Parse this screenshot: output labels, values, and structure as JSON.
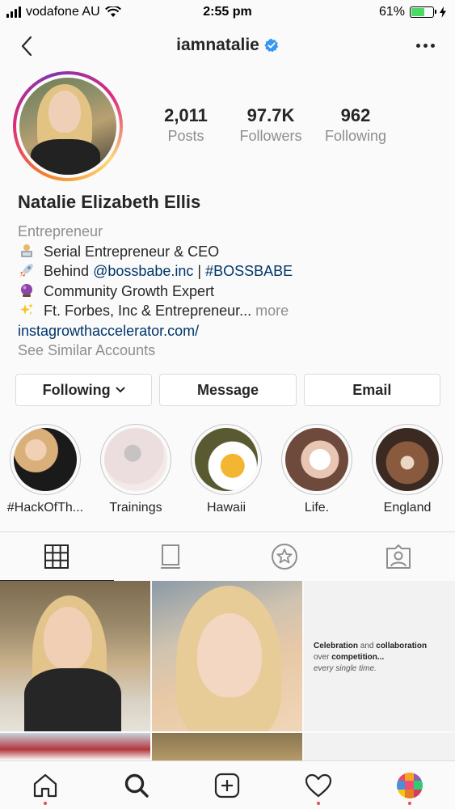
{
  "status_bar": {
    "carrier": "vodafone AU",
    "time": "2:55 pm",
    "battery_percent": "61%",
    "battery_level": 0.61
  },
  "header": {
    "username": "iamnatalie",
    "verified": true
  },
  "profile": {
    "posts_count": "2,011",
    "posts_label": "Posts",
    "followers_count": "97.7K",
    "followers_label": "Followers",
    "following_count": "962",
    "following_label": "Following"
  },
  "bio": {
    "full_name": "Natalie Elizabeth Ellis",
    "category": "Entrepreneur",
    "line1": "Serial Entrepreneur & CEO",
    "line2_prefix": "Behind ",
    "line2_mention": "@bossbabe.inc",
    "line2_sep": " | ",
    "line2_hashtag": "#BOSSBABE",
    "line3": "Community Growth Expert",
    "line4": "Ft. Forbes, Inc & Entrepreneur...",
    "more": "more",
    "website": "instagrowthaccelerator.com/",
    "see_similar": "See Similar Accounts"
  },
  "actions": {
    "following": "Following",
    "message": "Message",
    "email": "Email"
  },
  "highlights": [
    {
      "label": "#HackOfTh..."
    },
    {
      "label": "Trainings"
    },
    {
      "label": "Hawaii"
    },
    {
      "label": "Life."
    },
    {
      "label": "England"
    }
  ],
  "posts": {
    "quote_line1_a": "Celebration",
    "quote_line1_b": " and ",
    "quote_line1_c": "collaboration",
    "quote_line2_a": "over ",
    "quote_line2_b": "competition...",
    "quote_line3": "every single time."
  },
  "colors": {
    "accent_link": "#003569",
    "verified_blue": "#3897f0",
    "notification_red": "#ed4956"
  }
}
